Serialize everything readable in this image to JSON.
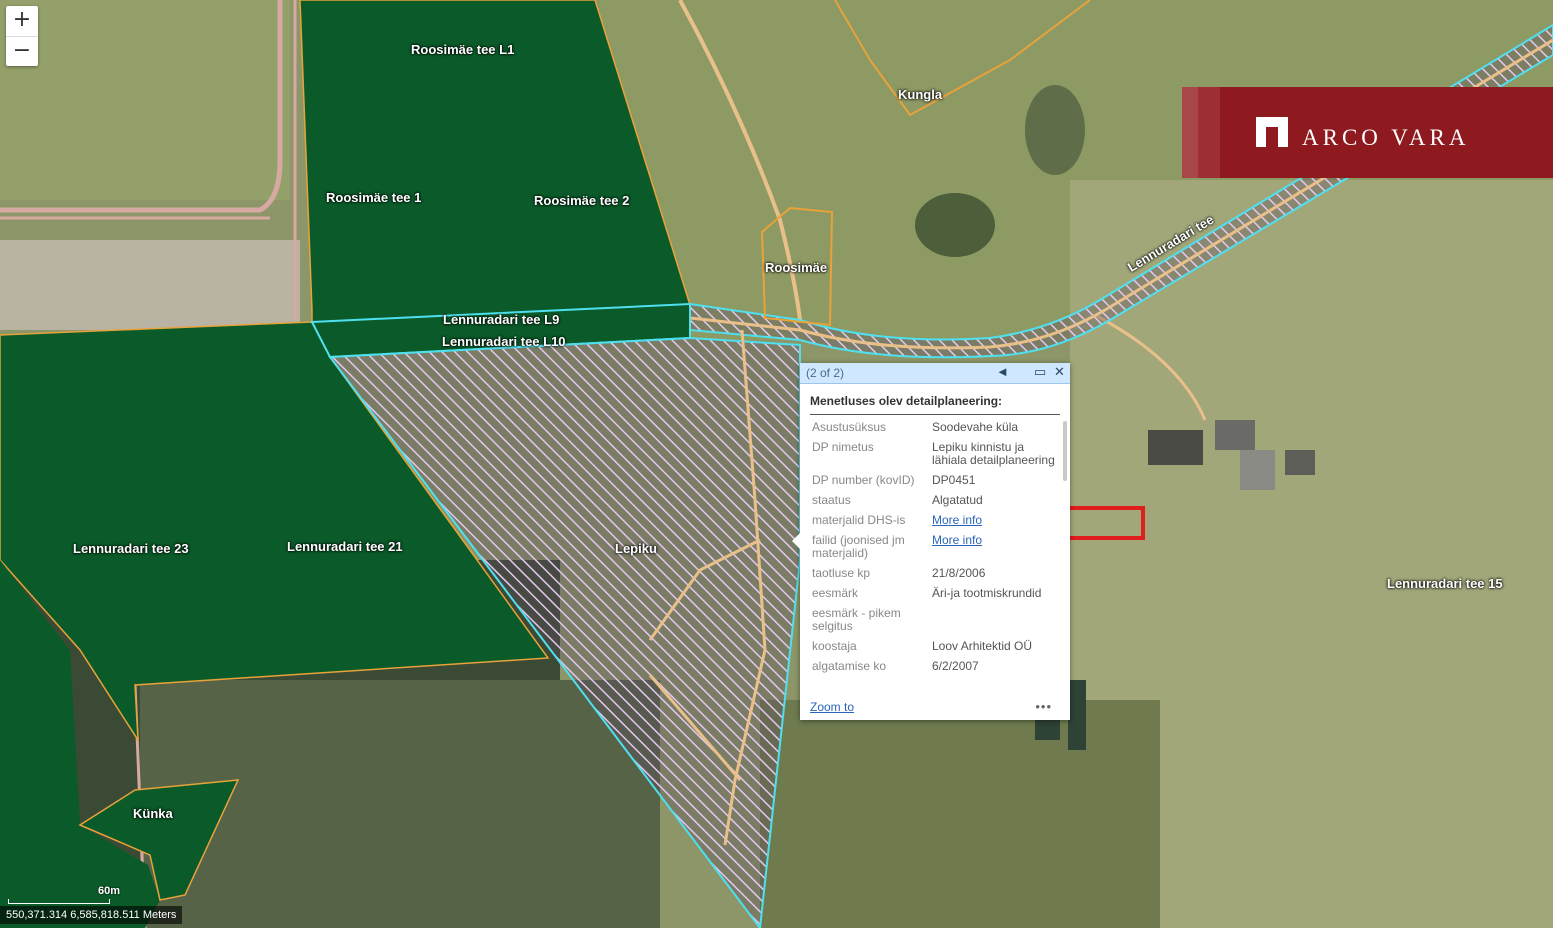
{
  "parcels": {
    "roosimae_l1": "Roosimäe tee L1",
    "roosimae_1": "Roosimäe tee 1",
    "roosimae_2": "Roosimäe tee 2",
    "roosimae": "Roosimäe",
    "kungla": "Kungla",
    "lennuradari_l9": "Lennuradari tee L9",
    "lennuradari_l10": "Lennuradari tee L10",
    "lennuradari_tee": "Lennuradari tee",
    "lennuradari_23": "Lennuradari tee 23",
    "lennuradari_21": "Lennuradari tee 21",
    "lennuradari_15": "Lennuradari tee 15",
    "lepiku": "Lepiku",
    "kunka": "Künka"
  },
  "colors": {
    "green_parcel": "#0b5b2a",
    "hatch": "#d9b8e6",
    "cyan_outline": "#4fe0ef",
    "orange_outline": "#e8a23a",
    "logo_red": "#8e1a1f"
  },
  "zoom": {
    "in": "+",
    "out": "−"
  },
  "logo": {
    "text": "ARCO VARA"
  },
  "popup": {
    "count": "(2 of 2)",
    "prev_icon": "◄",
    "maximize_icon": "▭",
    "close_icon": "✕",
    "title": "Menetluses olev detailplaneering:",
    "rows": [
      {
        "k": "Asustusüksus",
        "v": "Soodevahe küla"
      },
      {
        "k": "DP nimetus",
        "v": "Lepiku kinnistu ja lähiala detailplaneering"
      },
      {
        "k": "DP number (kovID)",
        "v": "DP0451"
      },
      {
        "k": "staatus",
        "v": "Algatatud"
      },
      {
        "k": "materjalid DHS-is",
        "v": "More info"
      },
      {
        "k": "failid (joonised jm materjalid)",
        "v": "More info"
      },
      {
        "k": "taotluse kp",
        "v": "21/8/2006"
      },
      {
        "k": "eesmärk",
        "v": "Äri-ja tootmiskrundid"
      },
      {
        "k": "eesmärk - pikem selgitus",
        "v": ""
      },
      {
        "k": "koostaja",
        "v": "Loov Arhitektid OÜ"
      },
      {
        "k": "algatamise ko",
        "v": "6/2/2007"
      }
    ],
    "zoom_to": "Zoom to",
    "more": "•••"
  },
  "scale": {
    "label": "60m"
  },
  "coords": {
    "text": "550,371.314 6,585,818.511 Meters"
  }
}
